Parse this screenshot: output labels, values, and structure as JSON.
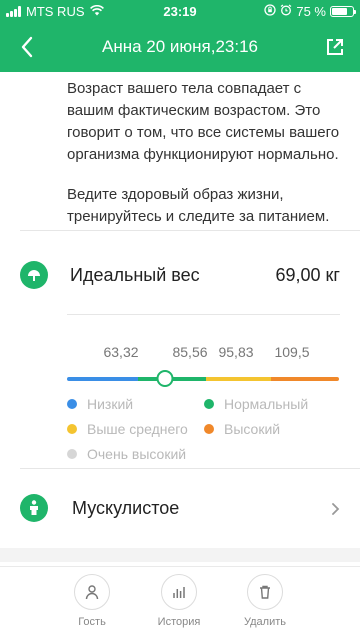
{
  "status_bar": {
    "carrier": "MTS RUS",
    "time": "23:19",
    "battery_percent": "75 %",
    "battery_level": 0.75
  },
  "nav": {
    "title": "Анна 20 июня,23:16"
  },
  "description": {
    "paragraph1": "Возраст вашего тела совпадает с вашим фактическим возрастом. Это говорит о том, что все системы вашего организма функционируют нормально.",
    "paragraph2": "Ведите здоровый образ жизни, тренируйтесь и следите за питанием."
  },
  "ideal_weight": {
    "label": "Идеальный вес",
    "value": "69,00 кг",
    "scale_ticks": [
      "63,32",
      "85,56",
      "95,83",
      "109,5"
    ],
    "indicator_fraction": 0.36,
    "segments": [
      {
        "name": "Низкий",
        "color": "#3a8ee6"
      },
      {
        "name": "Нормальный",
        "color": "#1fb56a"
      },
      {
        "name": "Выше среднего",
        "color": "#f4c430"
      },
      {
        "name": "Высокий",
        "color": "#f0882a"
      }
    ]
  },
  "legend": {
    "items": [
      {
        "label": "Низкий",
        "color": "#3a8ee6"
      },
      {
        "label": "Нормальный",
        "color": "#1fb56a"
      },
      {
        "label": "Выше среднего",
        "color": "#f4c430"
      },
      {
        "label": "Высокий",
        "color": "#f0882a"
      },
      {
        "label": "Очень высокий",
        "color": "#d6d6d6"
      }
    ]
  },
  "body_type": {
    "label": "Мускулистое"
  },
  "tabbar": {
    "guest": "Гость",
    "history": "История",
    "delete": "Удалить"
  }
}
